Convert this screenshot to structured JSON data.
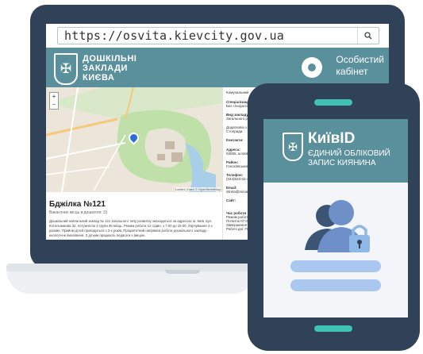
{
  "browser": {
    "url": "https://osvita.kievcity.gov.ua",
    "search_icon": "search-icon"
  },
  "site": {
    "title_line1": "ДОШКІЛЬНІ",
    "title_line2": "ЗАКЛАДИ",
    "title_line3": "КИЄВА",
    "cabinet_line1": "Особистий",
    "cabinet_line2": "кабінет"
  },
  "school": {
    "name": "Бджілка №121",
    "subtitle": "Вакантних місць в дошкілля: 31",
    "description": "Дошкільний навчальний заклад № 121 загального типу розвитку знаходиться за адресою: м. Київ, вул. Котельникова 32, потужністю 2 групи 35 місць. Режим роботи 12 годин, з 7.00 до 19.00. Харчування 4-х разове. Прийом дітей проводиться з 2-х років. Пріоритетний напрямок роботи дошкільного закладу - екологічне виховання. З дітьми працюють педагоги з вищою"
  },
  "info": {
    "type": "Комунальний",
    "specialization_label": "Спеціалізація:",
    "specialization_value": "Без спеціаліза",
    "kind_label": "Вид закладу:",
    "kind_value": "Загального роз",
    "language_label": "Додаткова о",
    "language_value": "Стоприда",
    "contacts_label": "Контакти:",
    "address_label": "Адреса:",
    "address_value": "03065, м.Київ",
    "district_label": "Район:",
    "district_value": "Голосіївський",
    "phone_label": "Телефон:",
    "phone_value": "(044)523-02-4",
    "email_label": "Email:",
    "email_value": "Strela@minia",
    "site_label": "Сайт:",
    "hours_label": "Час роботи",
    "hours_1": "Режим роботи",
    "hours_2": "Початок 07.00",
    "hours_3": "Завершення",
    "hours_4": "Робочі дні: Пон"
  },
  "map": {
    "zoom_in": "+",
    "zoom_out": "−",
    "attribution": "Leaflet | Data © OpenStreetMap"
  },
  "phone": {
    "app_name": "КиївID",
    "subtitle_line1": "ЄДИНИЙ ОБЛІКОВИЙ",
    "subtitle_line2": "ЗАПИС КИЯНИНА"
  },
  "colors": {
    "frame": "#2f4257",
    "header": "#5a8f9c",
    "accent": "#3fc1b5",
    "user_icon": "#6f8fc9",
    "lock": "#8fb8e6",
    "field": "#a9c7ef"
  }
}
